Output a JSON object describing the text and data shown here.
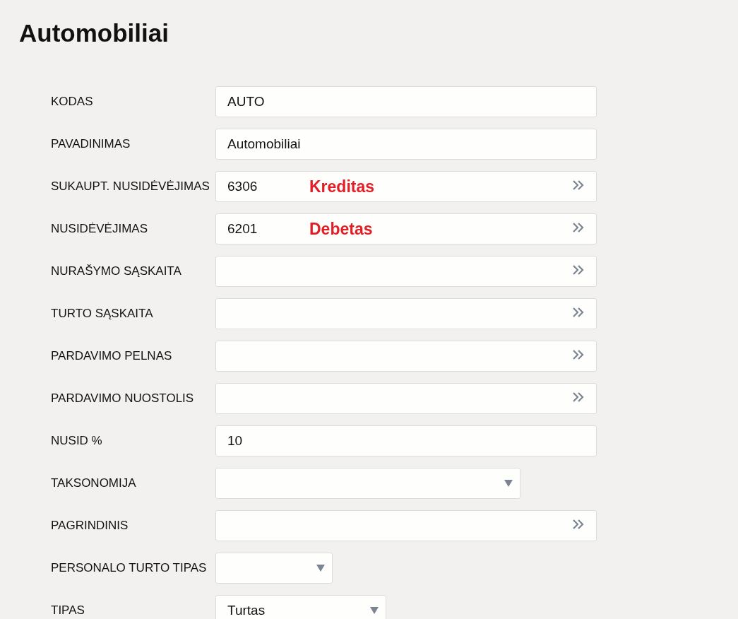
{
  "title": "Automobiliai",
  "fields": [
    {
      "label": "KODAS",
      "kind": "text",
      "value": "AUTO"
    },
    {
      "label": "PAVADINIMAS",
      "kind": "text",
      "value": "Automobiliai"
    },
    {
      "label": "SUKAUPT. NUSIDĖVĖJIMAS",
      "kind": "lookup",
      "value": "6306",
      "note": "Kreditas"
    },
    {
      "label": "NUSIDĖVĖJIMAS",
      "kind": "lookup",
      "value": "6201",
      "note": "Debetas"
    },
    {
      "label": "NURAŠYMO SĄSKAITA",
      "kind": "lookup"
    },
    {
      "label": "TURTO SĄSKAITA",
      "kind": "lookup"
    },
    {
      "label": "PARDAVIMO PELNAS",
      "kind": "lookup"
    },
    {
      "label": "PARDAVIMO NUOSTOLIS",
      "kind": "lookup"
    },
    {
      "label": "NUSID %",
      "kind": "text",
      "value": "10"
    },
    {
      "label": "TAKSONOMIJA",
      "kind": "select"
    },
    {
      "label": "PAGRINDINIS",
      "kind": "lookup"
    },
    {
      "label": "PERSONALO TURTO TIPAS",
      "kind": "select"
    },
    {
      "label": "TIPAS",
      "kind": "select",
      "value": "Turtas"
    }
  ]
}
